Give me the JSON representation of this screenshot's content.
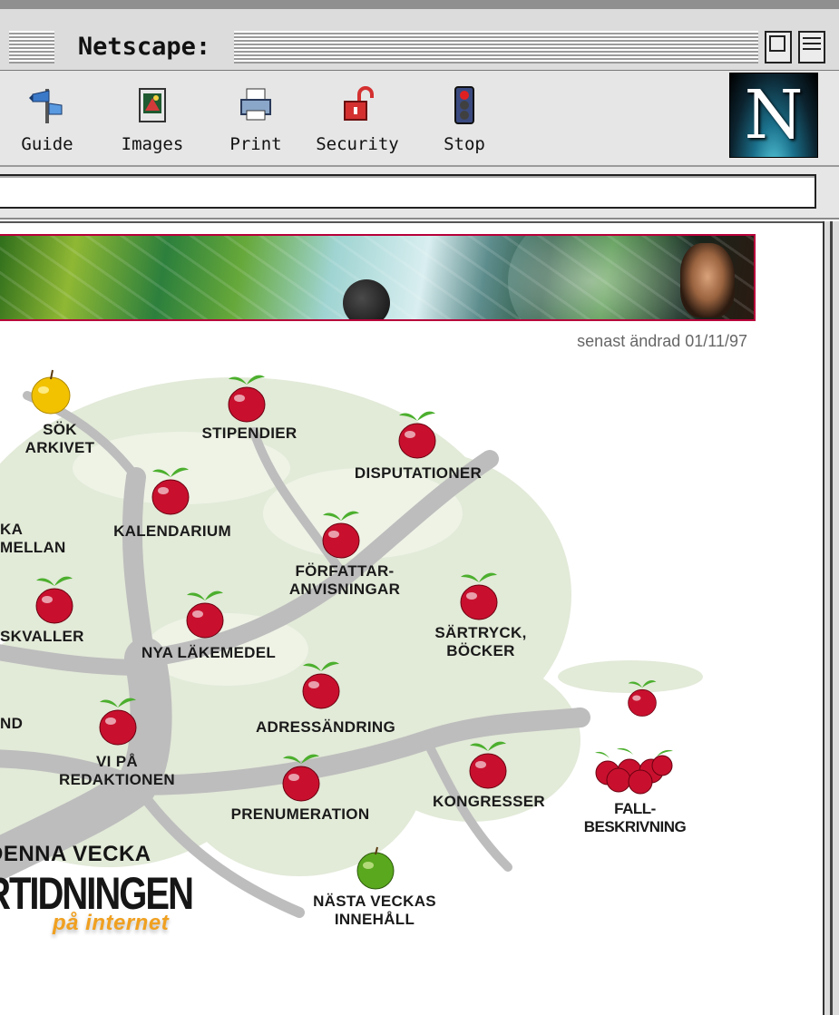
{
  "window": {
    "title": "Netscape:"
  },
  "toolbar": {
    "buttons": [
      {
        "id": "guide",
        "label": "Guide",
        "icon": "guide-icon"
      },
      {
        "id": "images",
        "label": "Images",
        "icon": "images-icon"
      },
      {
        "id": "print",
        "label": "Print",
        "icon": "print-icon"
      },
      {
        "id": "security",
        "label": "Security",
        "icon": "unlocked-padlock-icon"
      },
      {
        "id": "stop",
        "label": "Stop",
        "icon": "traffic-light-icon"
      }
    ],
    "logo_letter": "N"
  },
  "location": {
    "value": ""
  },
  "page": {
    "last_modified": "senast ändrad 01/11/97",
    "menu": {
      "sok_arkivet": [
        "SÖK",
        "ARKIVET"
      ],
      "stipendier": "STIPENDIER",
      "disputationer": "DISPUTATIONER",
      "kalendarium": "KALENDARIUM",
      "ka_mellan": [
        "KA",
        "MELLAN"
      ],
      "forfattar": [
        "FÖRFATTAR-",
        "ANVISNINGAR"
      ],
      "skvaller": "SKVALLER",
      "nya_lakemedel": "NYA LÄKEMEDEL",
      "sartryck": [
        "SÄRTRYCK,",
        "BÖCKER"
      ],
      "nd": "ND",
      "adressandring": "ADRESSÄNDRING",
      "vi_pa": [
        "VI PÅ",
        "REDAKTIONEN"
      ],
      "prenumeration": "PRENUMERATION",
      "kongresser": "KONGRESSER",
      "fall": [
        "FALL-",
        "BESKRIVNING"
      ],
      "nasta": [
        "NÄSTA VECKAS",
        "INNEHÅLL"
      ]
    },
    "logo": {
      "heading": "DENNA VECKA",
      "name": "LÄKARTIDNINGEN",
      "tagline": "på internet"
    },
    "colors": {
      "apple_red": "#c8102e",
      "apple_yellow": "#f2c200",
      "apple_green": "#5aa81e",
      "leaf": "#4caf2e",
      "tree_trunk": "#bdbdbd",
      "tree_foliage": "#dfe8d4",
      "banner_border": "#b8003a"
    }
  }
}
